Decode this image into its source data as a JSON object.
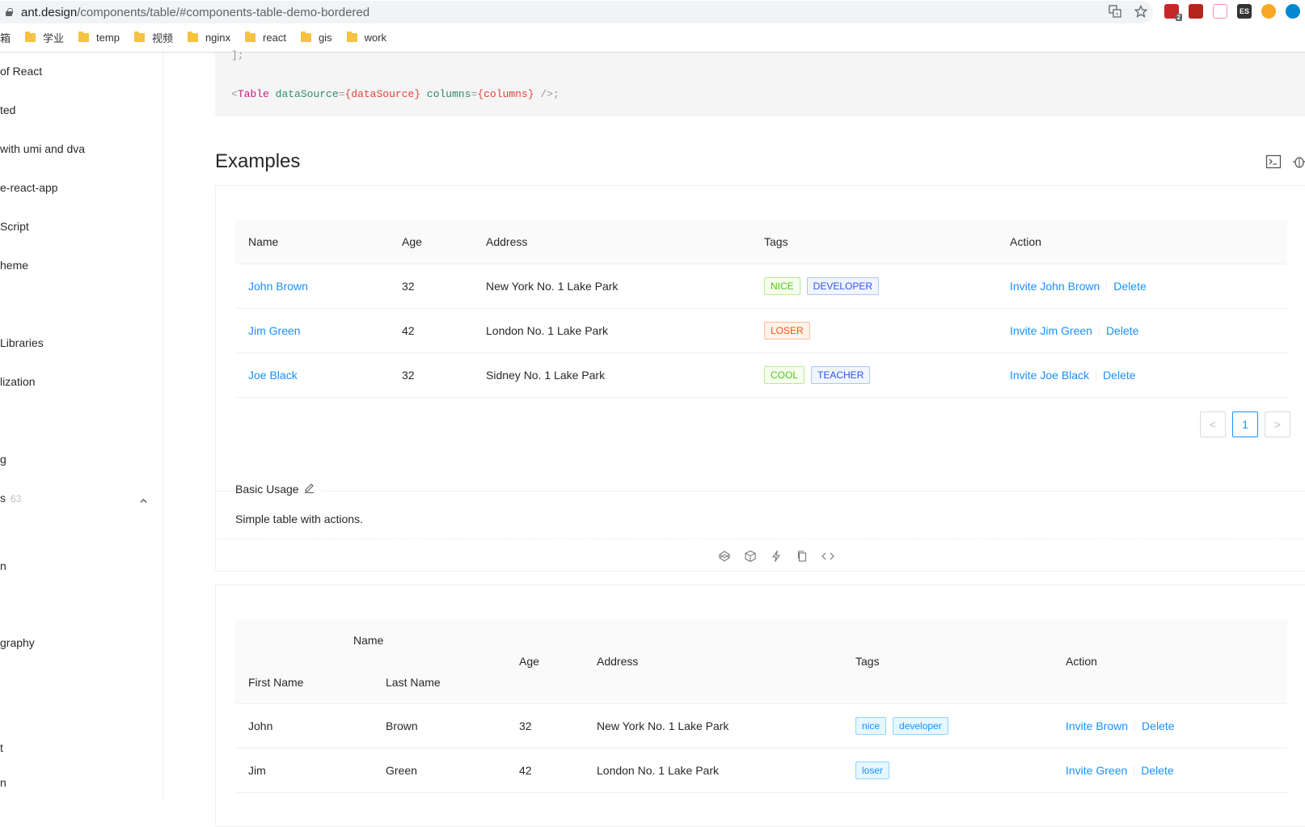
{
  "browser": {
    "url_host": "ant.design",
    "url_path": "/components/table/#components-table-demo-bordered",
    "ext_badge": "2",
    "ext_es_label": "ES",
    "bookmarks": [
      {
        "label": "箱"
      },
      {
        "label": "学业"
      },
      {
        "label": "temp"
      },
      {
        "label": "视频"
      },
      {
        "label": "nginx"
      },
      {
        "label": "react"
      },
      {
        "label": "gis"
      },
      {
        "label": "work"
      }
    ]
  },
  "sidebar": {
    "items": [
      {
        "label": "of React"
      },
      {
        "label": "ted"
      },
      {
        "label": " with umi and dva"
      },
      {
        "label": "e-react-app"
      },
      {
        "label": "Script"
      },
      {
        "label": "heme"
      },
      {
        "label": "Libraries"
      },
      {
        "label": "lization"
      },
      {
        "label": "g"
      },
      {
        "label": "s",
        "count": "63"
      },
      {
        "label": "n"
      },
      {
        "label": "graphy"
      },
      {
        "label": "t"
      },
      {
        "label": "n"
      }
    ]
  },
  "code": {
    "prev_line": "];",
    "open": "<",
    "tag": "Table",
    "attr1": "dataSource",
    "eq1": "=",
    "val1": "{dataSource}",
    "attr2": "columns",
    "eq2": "=",
    "val2": "{columns}",
    "close": "/>;"
  },
  "examples_title": "Examples",
  "demo1": {
    "columns": [
      "Name",
      "Age",
      "Address",
      "Tags",
      "Action"
    ],
    "rows": [
      {
        "name": "John Brown",
        "age": "32",
        "address": "New York No. 1 Lake Park",
        "tags": [
          "NICE",
          "DEVELOPER"
        ],
        "invite": "Invite John Brown",
        "delete": "Delete"
      },
      {
        "name": "Jim Green",
        "age": "42",
        "address": "London No. 1 Lake Park",
        "tags": [
          "LOSER"
        ],
        "invite": "Invite Jim Green",
        "delete": "Delete"
      },
      {
        "name": "Joe Black",
        "age": "32",
        "address": "Sidney No. 1 Lake Park",
        "tags": [
          "COOL",
          "TEACHER"
        ],
        "invite": "Invite Joe Black",
        "delete": "Delete"
      }
    ],
    "pagination": {
      "prev": "<",
      "page": "1",
      "next": ">"
    },
    "title": "Basic Usage",
    "description": "Simple table with actions."
  },
  "demo2": {
    "group_header": "Name",
    "sub_columns": [
      "First Name",
      "Last Name"
    ],
    "columns": [
      "Age",
      "Address",
      "Tags",
      "Action"
    ],
    "rows": [
      {
        "first": "John",
        "last": "Brown",
        "age": "32",
        "address": "New York No. 1 Lake Park",
        "tags": [
          "nice",
          "developer"
        ],
        "invite": "Invite Brown",
        "delete": "Delete"
      },
      {
        "first": "Jim",
        "last": "Green",
        "age": "42",
        "address": "London No. 1 Lake Park",
        "tags": [
          "loser"
        ],
        "invite": "Invite Green",
        "delete": "Delete"
      }
    ]
  },
  "colors": {
    "link": "#1890ff",
    "tag_green": "#52c41a",
    "tag_geekblue": "#2f54eb",
    "tag_volcano": "#fa541c",
    "tag_blue": "#1890ff"
  }
}
